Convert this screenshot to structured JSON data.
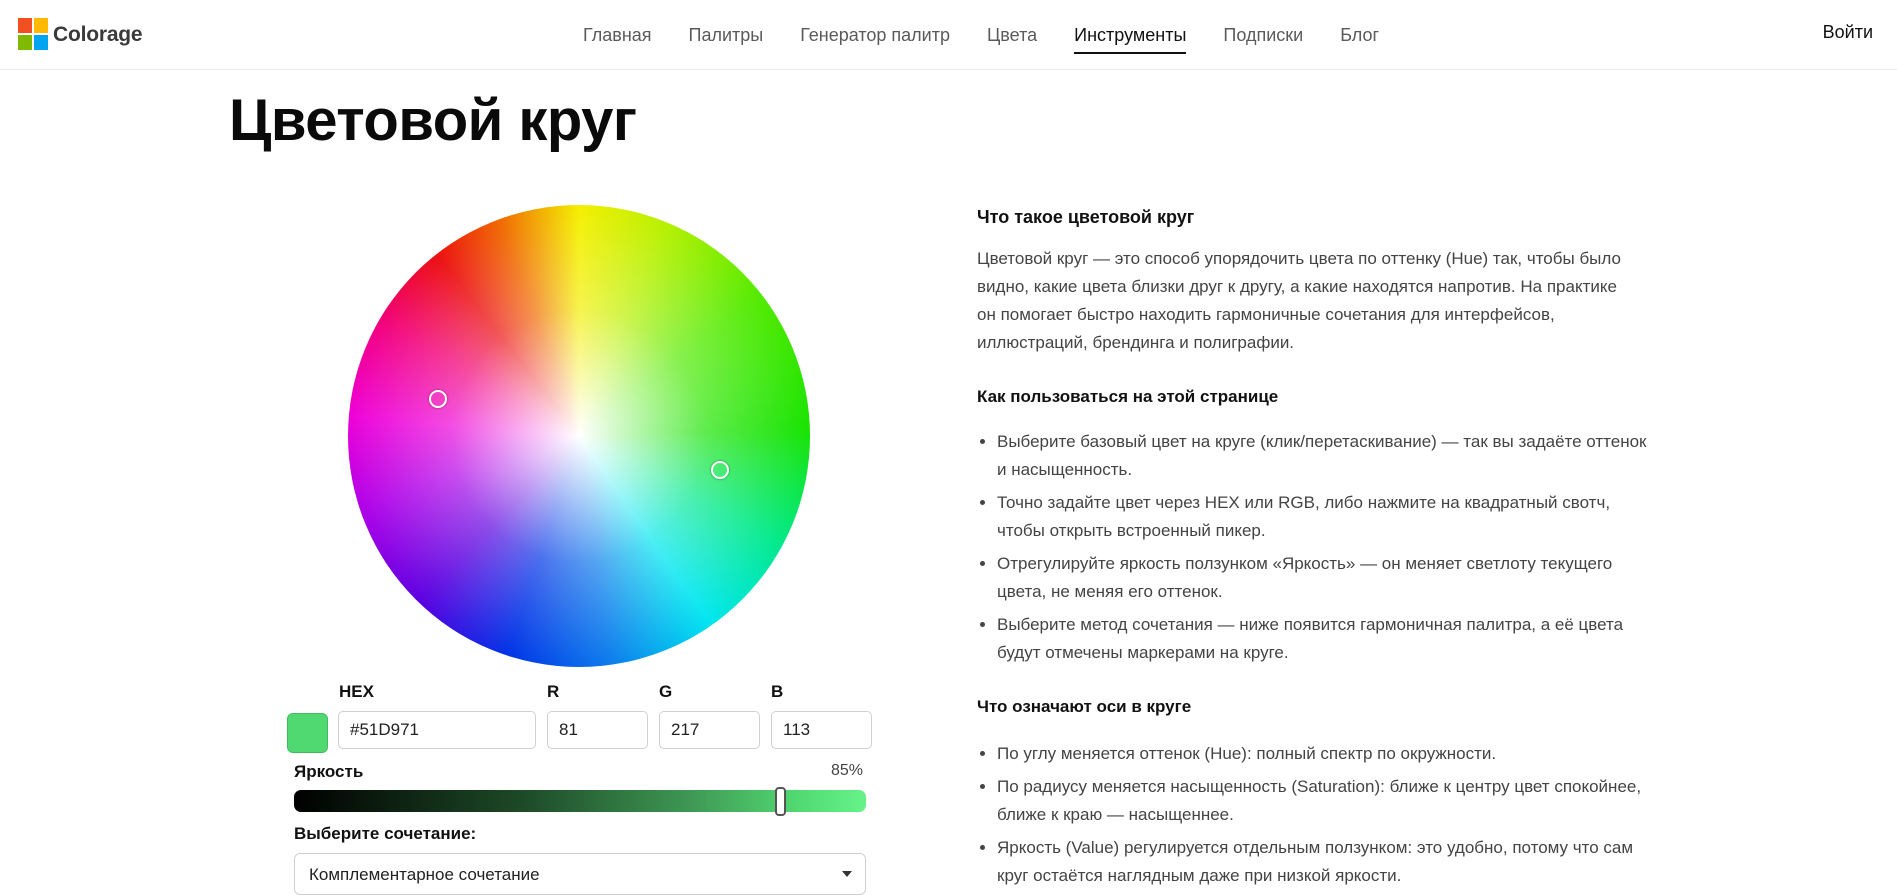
{
  "header": {
    "brand": "Colorage",
    "nav": [
      "Главная",
      "Палитры",
      "Генератор палитр",
      "Цвета",
      "Инструменты",
      "Подписки",
      "Блог"
    ],
    "active_nav": "Инструменты",
    "login": "Войти"
  },
  "page": {
    "title": "Цветовой круг"
  },
  "color": {
    "hex_label": "HEX",
    "hex_value": "#51D971",
    "r_label": "R",
    "r_value": "81",
    "g_label": "G",
    "g_value": "217",
    "b_label": "B",
    "b_value": "113",
    "swatch_color": "#51D971",
    "complement_color": "#d951b9"
  },
  "brightness": {
    "label": "Яркость",
    "value_text": "85%",
    "value": 0.85
  },
  "combination": {
    "label": "Выберите сочетание:",
    "selected": "Комплементарное сочетание"
  },
  "info": {
    "heading1": "Что такое цветовой круг",
    "paragraph1": "Цветовой круг — это способ упорядочить цвета по оттенку (Hue) так, чтобы было видно, какие цвета близки друг к другу, а какие находятся напротив. На практике он помогает быстро находить гармоничные сочетания для интерфейсов, иллюстраций, брендинга и полиграфии.",
    "heading2": "Как пользоваться на этой странице",
    "list1": [
      "Выберите базовый цвет на круге (клик/перетаскивание) — так вы задаёте оттенок и насыщенность.",
      "Точно задайте цвет через HEX или RGB, либо нажмите на квадратный свотч, чтобы открыть встроенный пикер.",
      "Отрегулируйте яркость ползунком «Яркость» — он меняет светлоту текущего цвета, не меняя его оттенок.",
      "Выберите метод сочетания — ниже появится гармоничная палитра, а её цвета будут отмечены маркерами на круге."
    ],
    "heading3": "Что означают оси в круге",
    "list2": [
      "По углу меняется оттенок (Hue): полный спектр по окружности.",
      "По радиусу меняется насыщенность (Saturation): ближе к центру цвет спокойнее, ближе к краю — насыщеннее.",
      "Яркость (Value) регулируется отдельным ползунком: это удобно, потому что сам круг остаётся наглядным даже при низкой яркости."
    ]
  }
}
